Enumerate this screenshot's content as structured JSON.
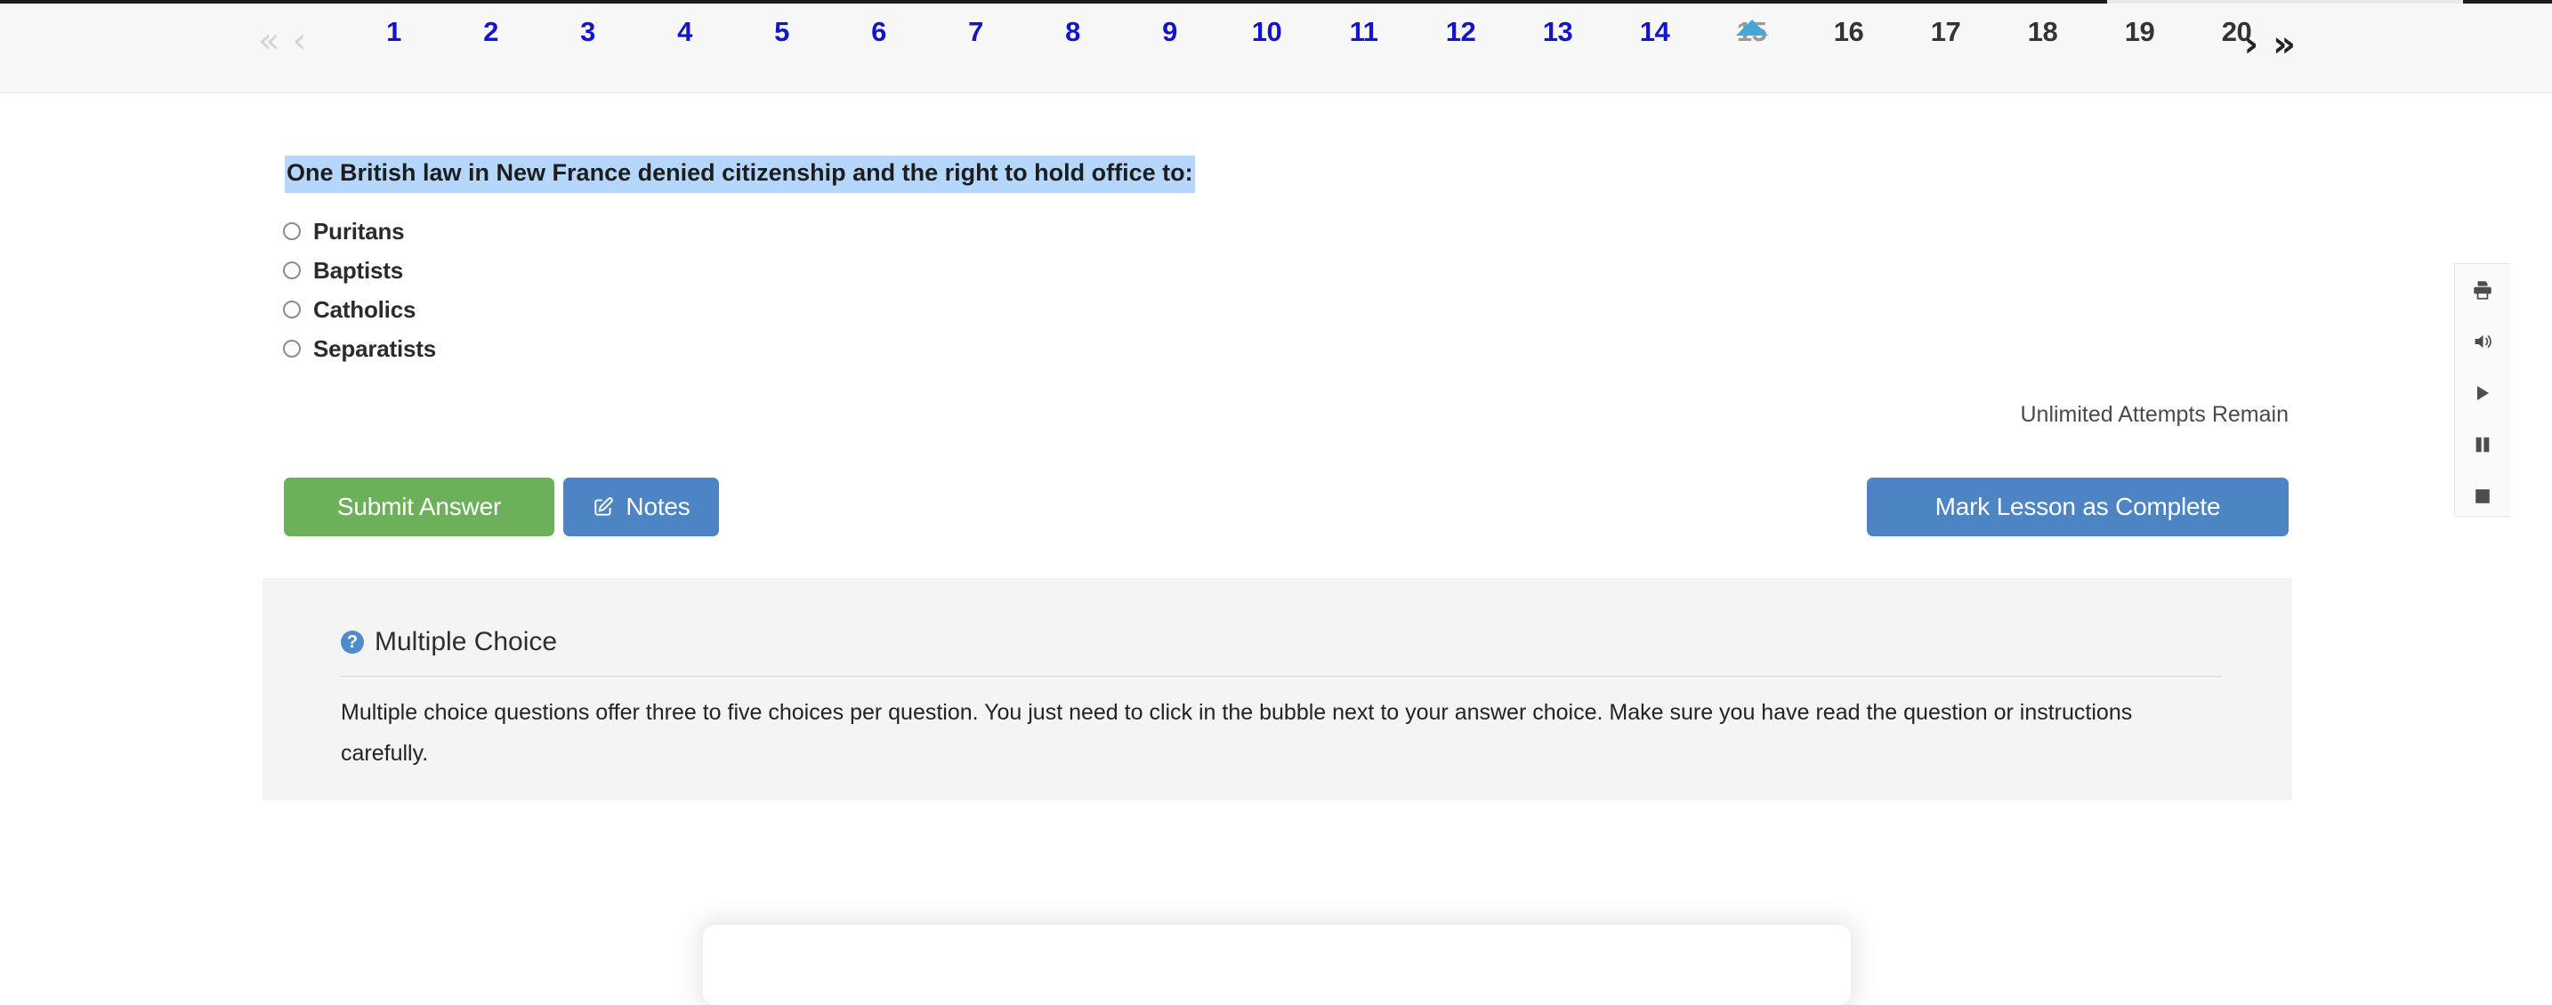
{
  "pagination": {
    "first_label": "«",
    "prev_label": "‹",
    "next_label": "›",
    "last_label": "»",
    "current": 15,
    "items": [
      {
        "label": "1",
        "state": "visited"
      },
      {
        "label": "2",
        "state": "visited"
      },
      {
        "label": "3",
        "state": "visited"
      },
      {
        "label": "4",
        "state": "visited"
      },
      {
        "label": "5",
        "state": "visited"
      },
      {
        "label": "6",
        "state": "visited"
      },
      {
        "label": "7",
        "state": "visited"
      },
      {
        "label": "8",
        "state": "visited"
      },
      {
        "label": "9",
        "state": "visited"
      },
      {
        "label": "10",
        "state": "visited"
      },
      {
        "label": "11",
        "state": "visited"
      },
      {
        "label": "12",
        "state": "visited"
      },
      {
        "label": "13",
        "state": "visited"
      },
      {
        "label": "14",
        "state": "visited"
      },
      {
        "label": "15",
        "state": "current"
      },
      {
        "label": "16",
        "state": "upcoming"
      },
      {
        "label": "17",
        "state": "upcoming"
      },
      {
        "label": "18",
        "state": "upcoming"
      },
      {
        "label": "19",
        "state": "upcoming"
      },
      {
        "label": "20",
        "state": "upcoming"
      }
    ]
  },
  "question": {
    "text": "One British law in New France denied citizenship and the right to hold office to:",
    "choices": [
      {
        "label": "Puritans",
        "selected": false
      },
      {
        "label": "Baptists",
        "selected": false
      },
      {
        "label": "Catholics",
        "selected": false
      },
      {
        "label": "Separatists",
        "selected": false
      }
    ],
    "attempts_text": "Unlimited Attempts Remain"
  },
  "actions": {
    "submit_label": "Submit Answer",
    "notes_label": "Notes",
    "notes_icon": "edit-square-icon",
    "complete_label": "Mark Lesson as Complete"
  },
  "info_panel": {
    "icon": "question-circle-icon",
    "title": "Multiple Choice",
    "body": "Multiple choice questions offer three to five choices per question. You just need to click in the bubble next to your answer choice. Make sure you have read the question or instructions carefully."
  },
  "media_toolbar": {
    "buttons": [
      {
        "name": "print-icon"
      },
      {
        "name": "volume-icon"
      },
      {
        "name": "play-icon"
      },
      {
        "name": "pause-icon"
      },
      {
        "name": "stop-icon"
      }
    ]
  },
  "colors": {
    "link_blue": "#1414cd",
    "current_gray": "#9a9a9a",
    "marker_blue": "#45a6d8",
    "highlight_blue": "#b5d6fd",
    "submit_green": "#6cb05a",
    "button_blue": "#4c84c4",
    "panel_gray": "#f4f4f4",
    "bar_gray": "#f7f7f7"
  }
}
